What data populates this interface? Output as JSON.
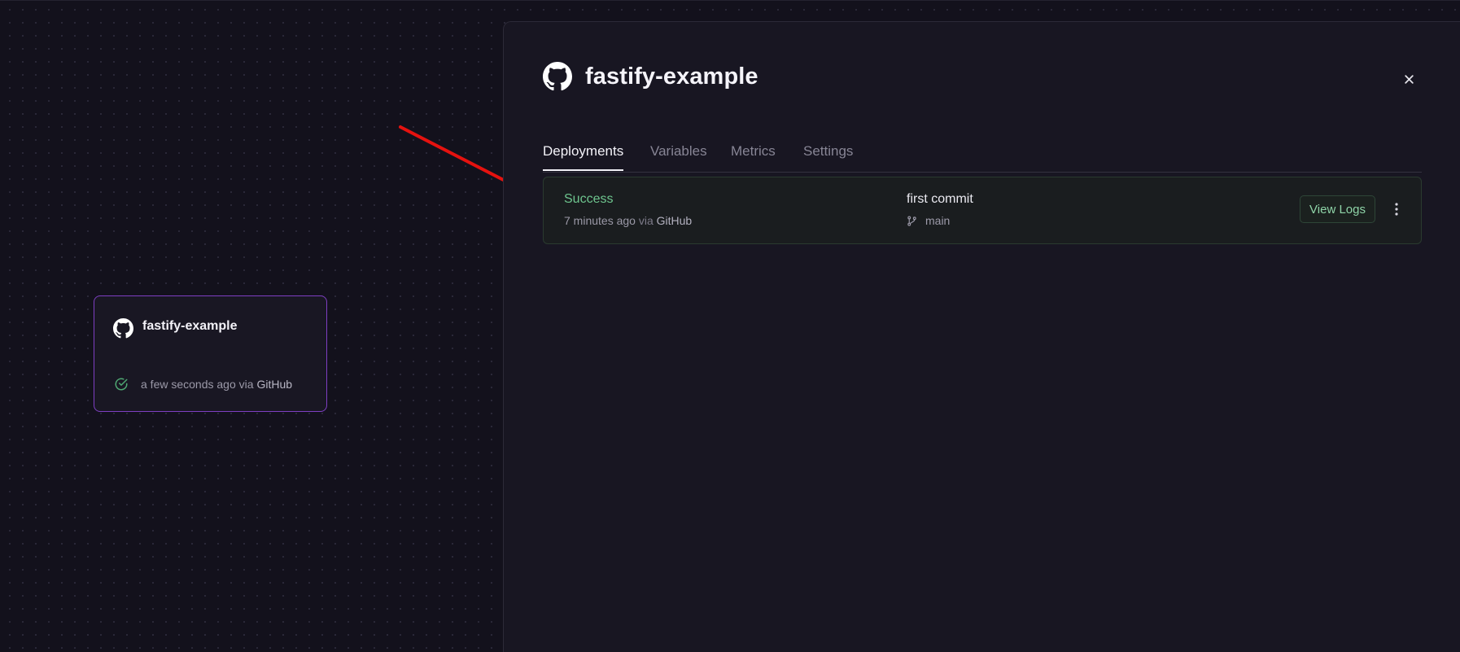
{
  "canvas": {
    "service_card": {
      "title": "fastify-example",
      "icon": "github-icon",
      "status_icon": "check-circle-icon",
      "status_time": "a few seconds ago",
      "status_via": "via",
      "status_provider": "GitHub",
      "border_color": "#7e3fc2"
    },
    "annotation": {
      "icon": "red-arrow",
      "color": "#e5120f"
    }
  },
  "panel": {
    "title": "fastify-example",
    "icon": "github-icon",
    "close_icon": "close-icon",
    "tabs": [
      {
        "label": "Deployments",
        "active": true
      },
      {
        "label": "Variables",
        "active": false
      },
      {
        "label": "Metrics",
        "active": false
      },
      {
        "label": "Settings",
        "active": false
      }
    ],
    "deployments": [
      {
        "status": "Success",
        "status_color": "#6ec58e",
        "time": "7 minutes ago",
        "via": "via",
        "provider": "GitHub",
        "commit_message": "first commit",
        "branch_icon": "git-branch-icon",
        "branch": "main",
        "view_logs_label": "View Logs",
        "more_icon": "more-vertical-icon"
      }
    ]
  }
}
